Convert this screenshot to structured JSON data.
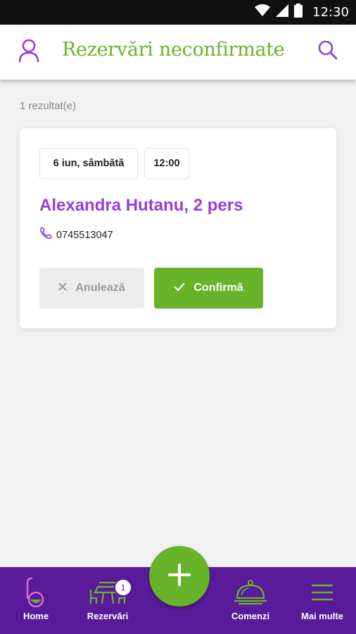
{
  "status_bar": {
    "time": "12:30"
  },
  "app_bar": {
    "title": "Rezervări neconfirmate"
  },
  "results": {
    "count_text": "1 rezultat(e)"
  },
  "reservation": {
    "date": "6 iun, sâmbătă",
    "time": "12:00",
    "guest": "Alexandra Hutanu, 2 pers",
    "phone": "0745513047",
    "cancel_label": "Anulează",
    "confirm_label": "Confirmă"
  },
  "bottom_nav": {
    "items": [
      {
        "label": "Home",
        "icon": "ladle-icon"
      },
      {
        "label": "Rezervări",
        "icon": "table-icon",
        "badge": "1"
      },
      {
        "label": "Comenzi",
        "icon": "cloche-icon"
      },
      {
        "label": "Mai multe",
        "icon": "menu-icon"
      }
    ]
  },
  "colors": {
    "accent_green": "#67b329",
    "accent_purple": "#9a3cdc",
    "nav_bg": "#5a1b9a"
  }
}
